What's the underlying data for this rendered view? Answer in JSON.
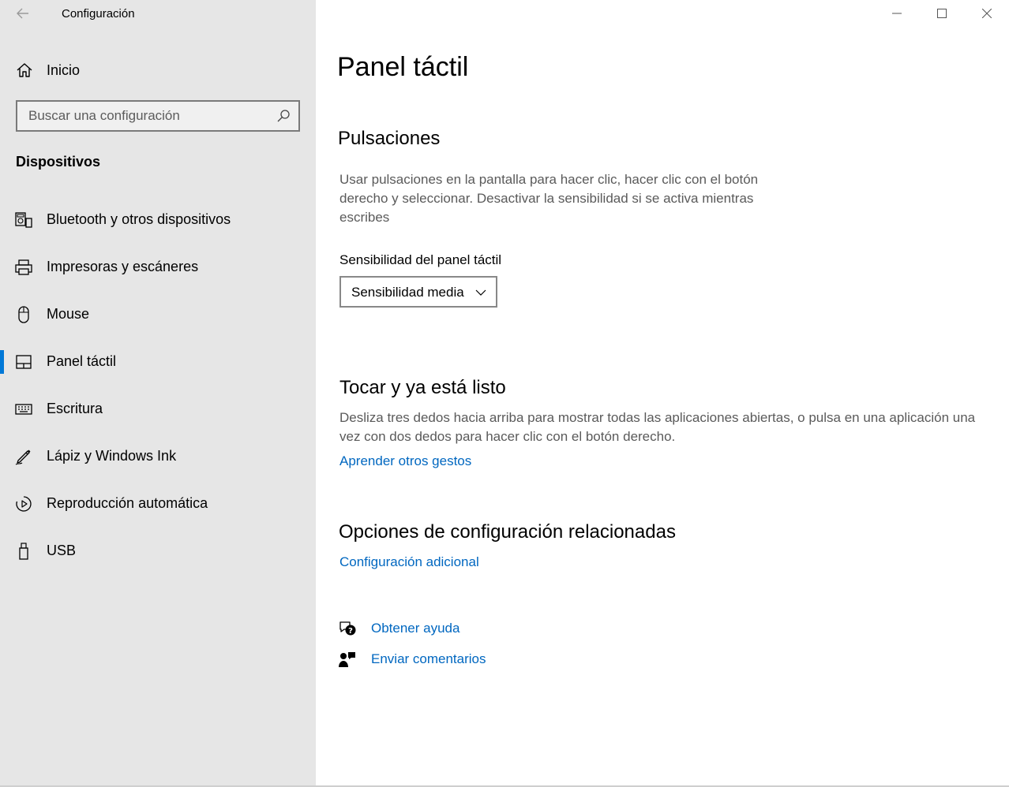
{
  "app": {
    "title": "Configuración"
  },
  "sidebar": {
    "home_label": "Inicio",
    "search_placeholder": "Buscar una configuración",
    "section_heading": "Dispositivos",
    "items": [
      {
        "label": "Bluetooth y otros dispositivos",
        "icon": "bluetooth-devices-icon"
      },
      {
        "label": "Impresoras y escáneres",
        "icon": "printer-icon"
      },
      {
        "label": "Mouse",
        "icon": "mouse-icon"
      },
      {
        "label": "Panel táctil",
        "icon": "touchpad-icon",
        "selected": true
      },
      {
        "label": "Escritura",
        "icon": "keyboard-icon"
      },
      {
        "label": "Lápiz y Windows Ink",
        "icon": "pen-icon"
      },
      {
        "label": "Reproducción automática",
        "icon": "autoplay-icon"
      },
      {
        "label": "USB",
        "icon": "usb-icon"
      }
    ]
  },
  "main": {
    "page_title": "Panel táctil",
    "taps": {
      "heading": "Pulsaciones",
      "description_lines": [
        "Usar pulsaciones en la pantalla para hacer clic, hacer clic con el botón",
        "derecho y seleccionar. Desactivar la sensibilidad si se activa mientras",
        "escribes"
      ],
      "sensitivity_label": "Sensibilidad del panel táctil",
      "sensitivity_value": "Sensibilidad media"
    },
    "touch": {
      "heading": "Tocar y ya está listo",
      "description_lines": [
        "Desliza tres dedos hacia arriba para mostrar todas las aplicaciones abiertas, o pulsa en una aplicación una",
        "vez con dos dedos para hacer clic con el botón derecho."
      ],
      "link": "Aprender otros gestos"
    },
    "related": {
      "heading": "Opciones de configuración relacionadas",
      "link": "Configuración adicional"
    },
    "help": {
      "get_help": "Obtener ayuda",
      "feedback": "Enviar comentarios"
    }
  },
  "colors": {
    "accent": "#0078d7",
    "link": "#0067c0",
    "sidebar_bg": "#e6e6e6"
  }
}
